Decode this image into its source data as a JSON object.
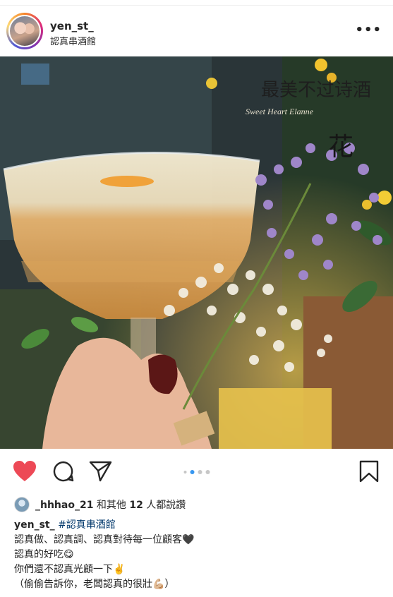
{
  "post": {
    "username": "yen_st_",
    "location": "認真串酒館",
    "more": "•••"
  },
  "photo": {
    "watermark_title": "最美不过诗酒",
    "watermark_sub": "Sweet Heart Elanne",
    "watermark_char": "花"
  },
  "carousel": {
    "total": 4,
    "active": 1
  },
  "likes": {
    "liker": "_hhhao_21",
    "text": " 和其他 ",
    "count": "12",
    "suffix": " 人都說讚"
  },
  "caption": {
    "username": "yen_st_",
    "hashtag": "#認真串酒館",
    "lines": [
      "認真做、認真調、認真對待每一位顧客🖤",
      "認真的好吃😋",
      "你們還不認真光顧一下✌️",
      "（偷偷告訴你，老闆認真的很壯💪🏼）"
    ]
  },
  "colors": {
    "like": "#ed4956",
    "hashtag": "#00376b",
    "dot_active": "#3897f0"
  }
}
